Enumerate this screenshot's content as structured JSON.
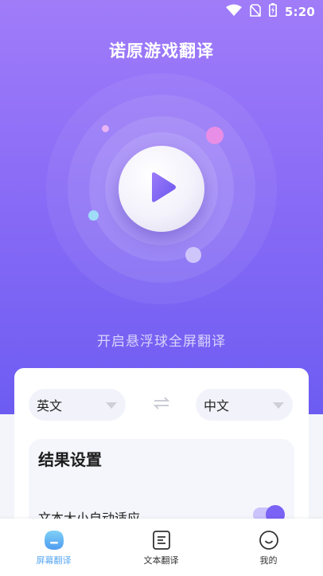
{
  "status_bar": {
    "time": "5:20",
    "icons": [
      "wifi-icon",
      "no-sim-icon",
      "battery-icon"
    ]
  },
  "header": {
    "title": "诺原游戏翻译"
  },
  "hero": {
    "hint": "开启悬浮球全屏翻译",
    "play_icon": "play-icon"
  },
  "languages": {
    "source": "英文",
    "target": "中文",
    "swap_icon": "swap-arrows-icon"
  },
  "settings": {
    "title": "结果设置",
    "rows": [
      {
        "label": "文本大小自动适应",
        "enabled": true
      }
    ]
  },
  "tabs": [
    {
      "label": "屏幕翻译",
      "icon": "screen-translate-icon",
      "active": true
    },
    {
      "label": "文本翻译",
      "icon": "document-icon",
      "active": false
    },
    {
      "label": "我的",
      "icon": "smiley-face-icon",
      "active": false
    }
  ],
  "colors": {
    "accent": "#7a63f5",
    "hero_top": "#a07cf9",
    "hero_bottom": "#6d5cf2",
    "tab_active": "#5aa8f0"
  }
}
